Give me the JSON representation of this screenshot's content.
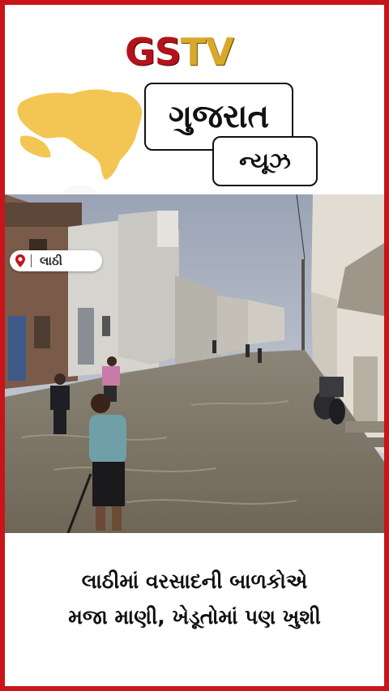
{
  "brand": {
    "part1": "GS",
    "part2": "TV"
  },
  "title_main": "ગુજરાત",
  "title_sub": "ન્યૂઝ",
  "location_tag": "લાઠી",
  "headline": {
    "line1": "લાઠીમાં વરસાદની બાળકોએ",
    "line2": "મજા માણી, ખેડૂતોમાં પણ ખુશી"
  },
  "colors": {
    "border": "#c8141b",
    "brand_red": "#b3131a",
    "brand_gold": "#d8a82a",
    "map": "#f3c653"
  },
  "icons": [
    "gujarat-map-icon",
    "location-pin-icon"
  ]
}
